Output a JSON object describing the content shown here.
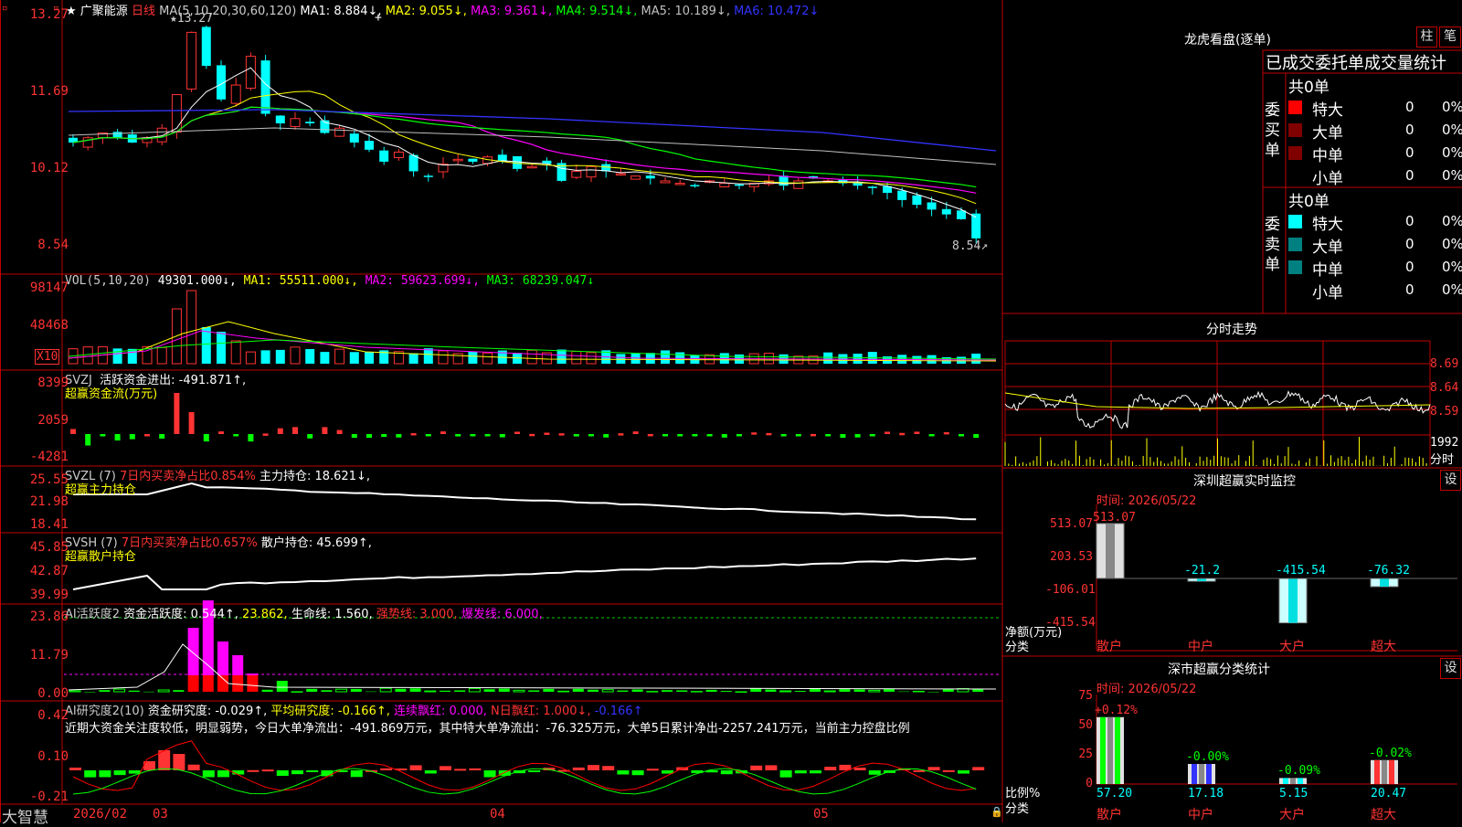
{
  "header": {
    "star": "★",
    "stock_name": "广聚能源",
    "period": "日线",
    "ma_title": "MA(5,10,20,30,60,120)",
    "ma1": "MA1: 8.884↓,",
    "ma2": "MA2: 9.055↓,",
    "ma3": "MA3: 9.361↓,",
    "ma4": "MA4: 9.514↓,",
    "ma5": "MA5: 10.189↓,",
    "ma6": "MA6: 10.472↓",
    "high_label": "13.27",
    "low_label": "8.54",
    "cross": "+"
  },
  "colors": {
    "ma1": "#ffffff",
    "ma2": "#ffff00",
    "ma3": "#ff00ff",
    "ma4": "#00ff00",
    "ma5": "#c0c0c0",
    "ma6": "#3333ff",
    "up": "#ff3333",
    "down": "#00ffff"
  },
  "price_axis": [
    "13.27",
    "11.69",
    "10.12",
    "8.54"
  ],
  "vol": {
    "title": "VOL(5,10,20)",
    "value": "49301.000↓,",
    "ma1": "MA1: 55511.000↓,",
    "ma2": "MA2: 59623.699↓,",
    "ma3": "MA3: 68239.047↓",
    "axis": [
      "98147",
      "48468"
    ],
    "unit": "X10"
  },
  "svzj": {
    "title": "SVZJ",
    "text": "活跃资金进出: -491.871↑,",
    "sub": "超赢资金流(万元)",
    "axis": [
      "8399",
      "2059",
      "-4281"
    ]
  },
  "svzl": {
    "title": "SVZL (7)",
    "text1": "7日内买卖净占比0.854%",
    "text2": "主力持仓: 18.621↓,",
    "sub": "超赢主力持仓",
    "axis": [
      "25.55",
      "21.98",
      "18.41"
    ]
  },
  "svsh": {
    "title": "SVSH (7)",
    "text1": "7日内买卖净占比0.657%",
    "text2": "散户持仓: 45.699↑,",
    "sub": "超赢散户持仓",
    "axis": [
      "45.85",
      "42.87",
      "39.99"
    ]
  },
  "ai1": {
    "title": "AI活跃度2",
    "t1": "资金活跃度: 0.544↑,",
    "t2": "23.862,",
    "t3": "生命线: 1.560,",
    "t4": "强势线: 3.000,",
    "t5": "爆发线: 6.000,",
    "axis": [
      "23.86",
      "11.79",
      "0.00"
    ]
  },
  "ai2": {
    "title": "AI研究度2(10)",
    "t1": "资金研究度: -0.029↑,",
    "t2": "平均研究度: -0.166↑,",
    "t3": "连续飘红: 0.000,",
    "t4": "N日飘红: 1.000↓,",
    "t5": "-0.166↑",
    "desc": "近期大资金关注度较低，明显弱势，今日大单净流出：-491.869万元，其中特大单净流出：-76.325万元，大单5日累计净出-2257.241万元，当前主力控盘比例",
    "axis": [
      "0.42",
      "0.10",
      "-0.21"
    ]
  },
  "footer": {
    "brand": "大智慧",
    "dates": [
      "2026/02",
      "03",
      "04",
      "05"
    ]
  },
  "dragon": {
    "title": "龙虎看盘(逐单)",
    "btn1": "柱",
    "btn2": "笔",
    "header": "已成交委托单成交量统计",
    "buy_total": "共0单",
    "sell_total": "共0单",
    "buy_side": "委买单",
    "sell_side": "委卖单",
    "buy_rows": [
      {
        "name": "特大",
        "count": "0",
        "pct": "0%"
      },
      {
        "name": "大单",
        "count": "0",
        "pct": "0%"
      },
      {
        "name": "中单",
        "count": "0",
        "pct": "0%"
      },
      {
        "name": "小单",
        "count": "0",
        "pct": "0%"
      }
    ],
    "sell_rows": [
      {
        "name": "特大",
        "count": "0",
        "pct": "0%"
      },
      {
        "name": "大单",
        "count": "0",
        "pct": "0%"
      },
      {
        "name": "中单",
        "count": "0",
        "pct": "0%"
      },
      {
        "name": "小单",
        "count": "0",
        "pct": "0%"
      }
    ]
  },
  "intraday": {
    "title": "分时走势",
    "axis": [
      "8.69",
      "8.64",
      "8.59"
    ],
    "vol_axis": "1992",
    "vol_unit": "分时"
  },
  "monitor": {
    "title": "深圳超赢实时监控",
    "btn": "设",
    "time": "时间: 2026/05/22",
    "axis": [
      "513.07",
      "203.53",
      "-106.01",
      "-415.54"
    ],
    "ylabel1": "净额(万元)",
    "ylabel2": "分类",
    "bars": [
      {
        "name": "散户",
        "value": "513.07"
      },
      {
        "name": "中户",
        "value": "-21.2"
      },
      {
        "name": "大户",
        "value": "-415.54"
      },
      {
        "name": "超大",
        "value": "-76.32"
      }
    ]
  },
  "classify": {
    "title": "深市超赢分类统计",
    "btn": "设",
    "time": "时间: 2026/05/22",
    "axis": [
      "75",
      "50",
      "25",
      "0"
    ],
    "ylabel1": "比例%",
    "ylabel2": "分类",
    "bars": [
      {
        "name": "散户",
        "value": "57.20",
        "change": "+0.12%"
      },
      {
        "name": "中户",
        "value": "17.18",
        "change": "-0.00%"
      },
      {
        "name": "大户",
        "value": "5.15",
        "change": "-0.09%"
      },
      {
        "name": "超大",
        "value": "20.47",
        "change": "-0.02%"
      }
    ]
  }
}
